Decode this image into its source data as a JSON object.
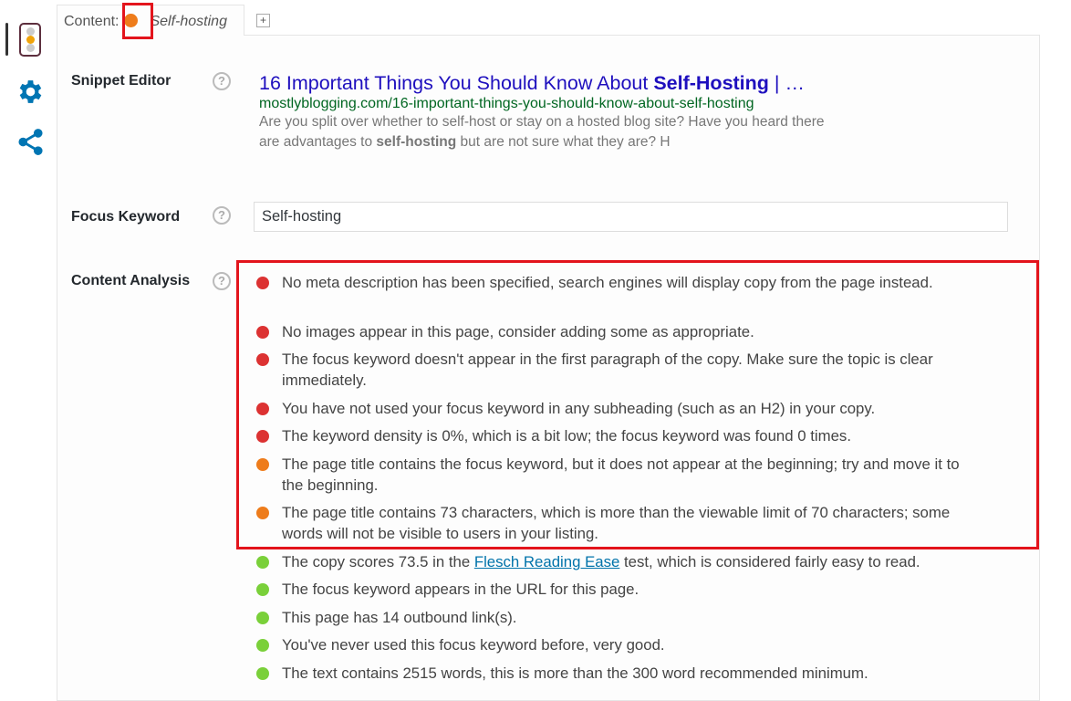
{
  "sidebar": {
    "items": [
      {
        "icon": "traffic-light-icon",
        "active": true
      },
      {
        "icon": "gear-icon"
      },
      {
        "icon": "share-icon"
      }
    ]
  },
  "tab": {
    "prefix": "Content:",
    "status_color": "#ee7c1b",
    "keyword": "Self-hosting",
    "add_label": "+"
  },
  "snippet": {
    "label": "Snippet Editor",
    "title_pre": "16 Important Things You Should Know About ",
    "title_bold": "Self-Hosting",
    "title_post": " | …",
    "url": "mostlyblogging.com/16-important-things-you-should-know-about-self-hosting",
    "desc_pre": "Are you split over whether to self-host or stay on a hosted blog site? Have you heard there are advantages to ",
    "desc_bold": "self-hosting",
    "desc_post": " but are not sure what they are? H"
  },
  "focus": {
    "label": "Focus Keyword",
    "value": "Self-hosting"
  },
  "help_label": "?",
  "analysis": {
    "label": "Content Analysis",
    "colors": {
      "bad": "#dc3232",
      "ok": "#ee7c1b",
      "good": "#7ad03a"
    },
    "items": [
      {
        "status": "bad",
        "text": "No meta description has been specified, search engines will display copy from the page instead."
      },
      {
        "status": "bad",
        "text": "No images appear in this page, consider adding some as appropriate."
      },
      {
        "status": "bad",
        "text": "The focus keyword doesn't appear in the first paragraph of the copy. Make sure the topic is clear immediately."
      },
      {
        "status": "bad",
        "text": "You have not used your focus keyword in any subheading (such as an H2) in your copy."
      },
      {
        "status": "bad",
        "text": "The keyword density is 0%, which is a bit low; the focus keyword was found 0 times."
      },
      {
        "status": "ok",
        "text": "The page title contains the focus keyword, but it does not appear at the beginning; try and move it to the beginning."
      },
      {
        "status": "ok",
        "text": "The page title contains 73 characters, which is more than the viewable limit of 70 characters; some words will not be visible to users in your listing."
      },
      {
        "status": "good",
        "pre": "The copy scores 73.5 in the ",
        "link": "Flesch Reading Ease",
        "post": " test, which is considered fairly easy to read."
      },
      {
        "status": "good",
        "text": "The focus keyword appears in the URL for this page."
      },
      {
        "status": "good",
        "text": "This page has 14 outbound link(s)."
      },
      {
        "status": "good",
        "text": "You've never used this focus keyword before, very good."
      },
      {
        "status": "good",
        "text": "The text contains 2515 words, this is more than the 300 word recommended minimum."
      }
    ]
  }
}
